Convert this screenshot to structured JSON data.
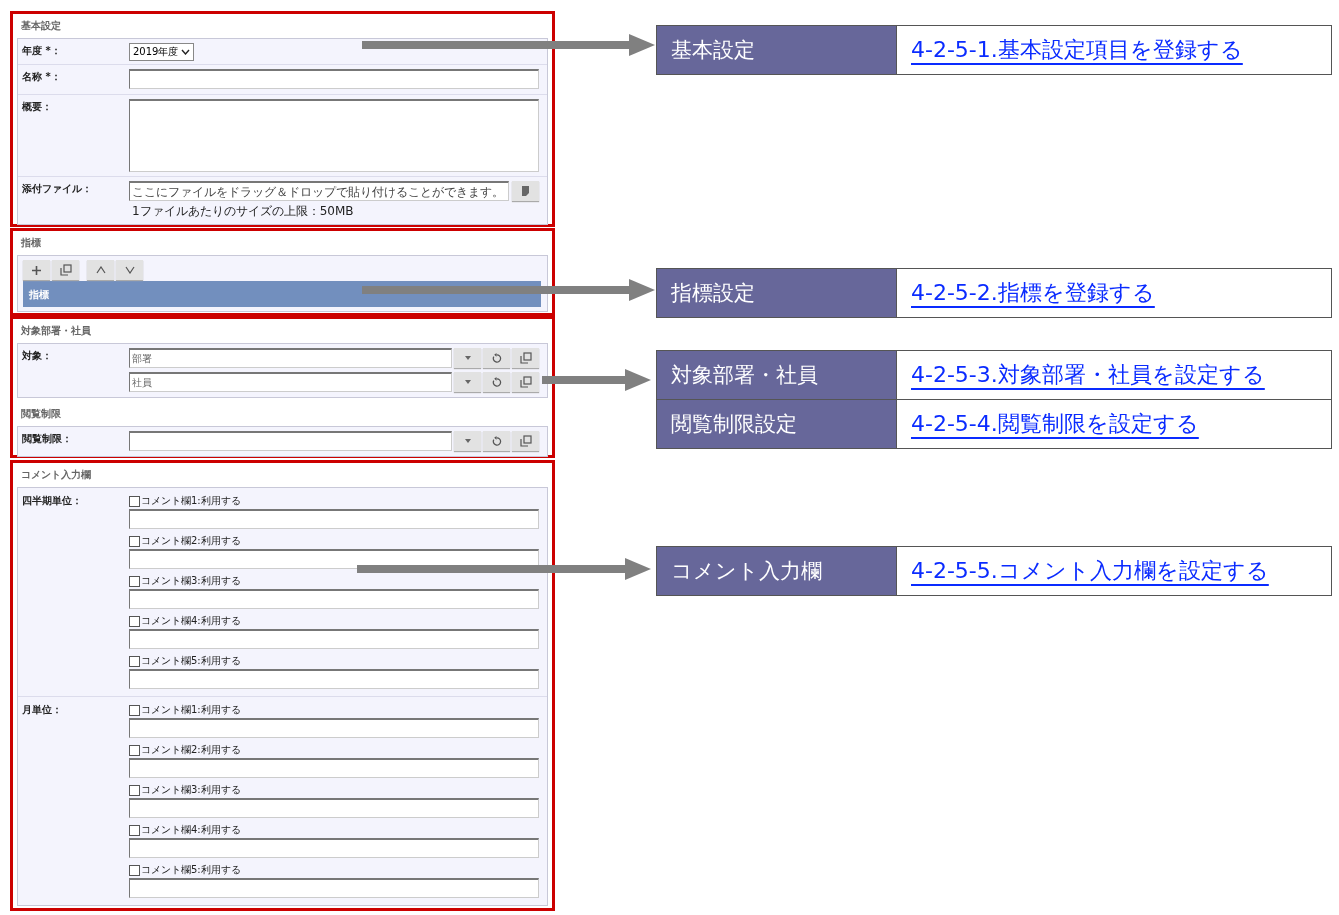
{
  "basic_settings": {
    "title": "基本設定",
    "fiscal_year": {
      "label": "年度 *：",
      "value": "2019年度"
    },
    "name": {
      "label": "名称 *："
    },
    "summary": {
      "label": "概要："
    },
    "attachment": {
      "label": "添付ファイル：",
      "placeholder": "ここにファイルをドラッグ＆ドロップで貼り付けることができます。",
      "note": "1ファイルあたりのサイズの上限：50MB"
    }
  },
  "indicators": {
    "title": "指標",
    "list_header": "指標"
  },
  "targets": {
    "title": "対象部署・社員",
    "label": "対象：",
    "fields": [
      {
        "placeholder": "部署"
      },
      {
        "placeholder": "社員"
      }
    ]
  },
  "access": {
    "title": "閲覧制限",
    "label": "閲覧制限："
  },
  "comments": {
    "title": "コメント入力欄",
    "groups": [
      {
        "label": "四半期単位：",
        "items": [
          {
            "label": "コメント欄1:利用する",
            "checked": false
          },
          {
            "label": "コメント欄2:利用する",
            "checked": false
          },
          {
            "label": "コメント欄3:利用する",
            "checked": false
          },
          {
            "label": "コメント欄4:利用する",
            "checked": false
          },
          {
            "label": "コメント欄5:利用する",
            "checked": false
          }
        ]
      },
      {
        "label": "月単位：",
        "items": [
          {
            "label": "コメント欄1:利用する",
            "checked": false
          },
          {
            "label": "コメント欄2:利用する",
            "checked": false
          },
          {
            "label": "コメント欄3:利用する",
            "checked": false
          },
          {
            "label": "コメント欄4:利用する",
            "checked": false
          },
          {
            "label": "コメント欄5:利用する",
            "checked": false
          }
        ]
      }
    ]
  },
  "callouts": [
    {
      "label": "基本設定",
      "link": "4-2-5-1.基本設定項目を登録する"
    },
    {
      "label": "指標設定",
      "link": "4-2-5-2.指標を登録する"
    },
    {
      "label": "対象部署・社員",
      "link": "4-2-5-3.対象部署・社員を設定する"
    },
    {
      "label": "閲覧制限設定",
      "link": "4-2-5-4.閲覧制限を設定する"
    },
    {
      "label": "コメント入力欄",
      "link": "4-2-5-5.コメント入力欄を設定する"
    }
  ]
}
